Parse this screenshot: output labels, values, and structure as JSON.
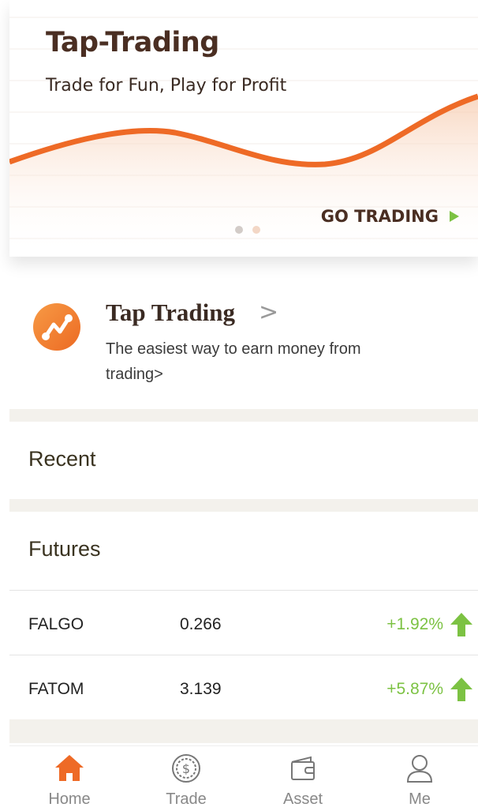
{
  "banner": {
    "title": "Tap-Trading",
    "subtitle": "Trade for Fun, Play for Profit",
    "cta": "GO TRADING",
    "page_indicator": {
      "count": 2,
      "active": 1
    }
  },
  "promo": {
    "title": "Tap Trading",
    "description": "The easiest way to earn money from trading>"
  },
  "sections": {
    "recent": "Recent",
    "futures": "Futures"
  },
  "futures": [
    {
      "symbol": "FALGO",
      "price": "0.266",
      "change": "+1.92%"
    },
    {
      "symbol": "FATOM",
      "price": "3.139",
      "change": "+5.87%"
    }
  ],
  "tabs": [
    {
      "label": "Home",
      "icon": "home-icon",
      "active": true
    },
    {
      "label": "Trade",
      "icon": "trade-dollar-icon",
      "active": false
    },
    {
      "label": "Asset",
      "icon": "wallet-icon",
      "active": false
    },
    {
      "label": "Me",
      "icon": "user-icon",
      "active": false
    }
  ],
  "colors": {
    "accent": "#ee6a26",
    "positive": "#7cc243",
    "title": "#4a2e22"
  }
}
